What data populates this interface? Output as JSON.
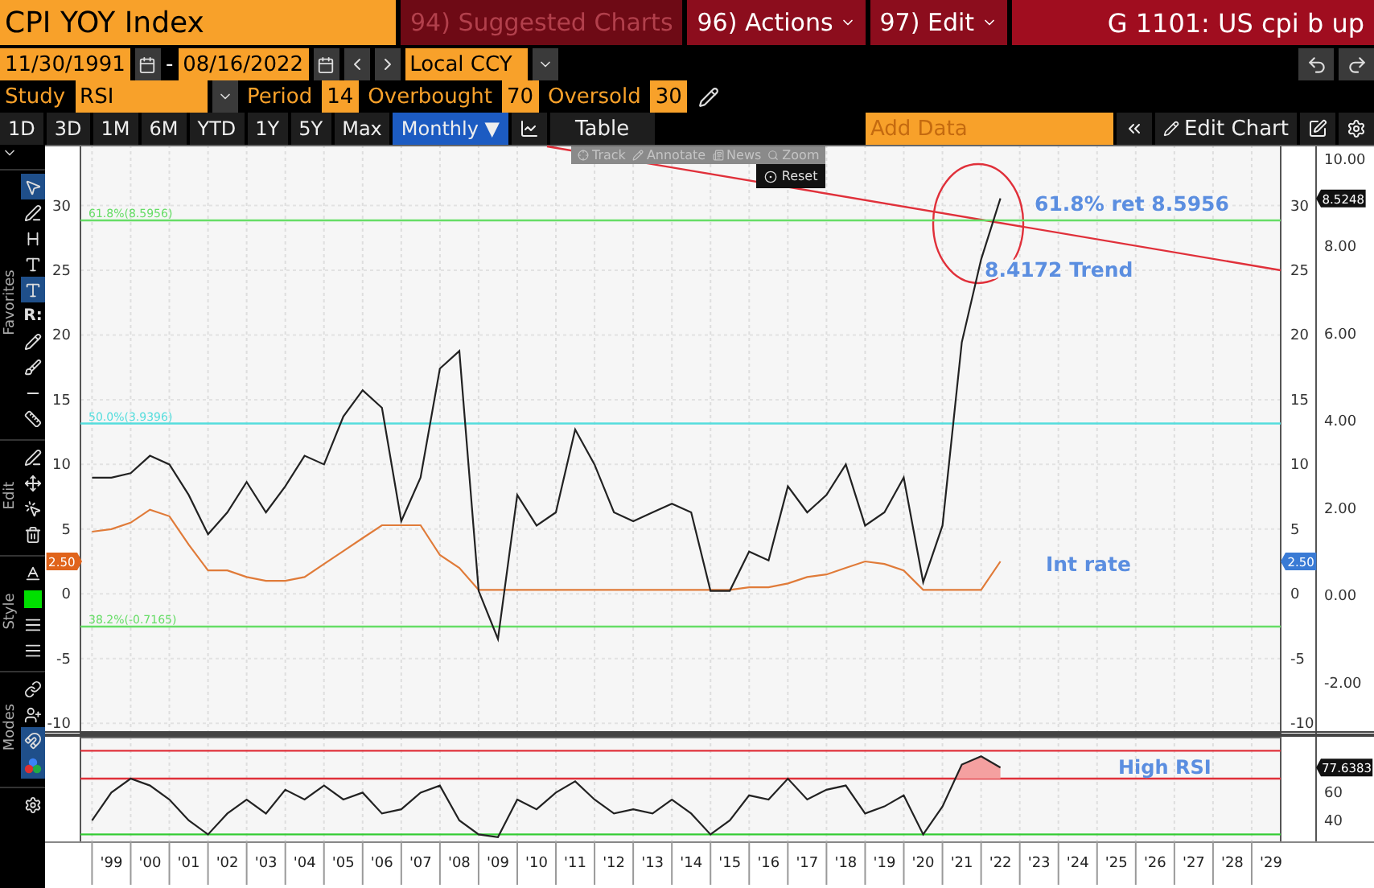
{
  "header": {
    "security": "CPI YOY Index",
    "menus": [
      {
        "label": "94) Suggested Charts",
        "kind": "faded"
      },
      {
        "label": "96) Actions",
        "kind": "dropdown"
      },
      {
        "label": "97) Edit",
        "kind": "dropdown"
      }
    ],
    "title": "G 1101: US cpi b up"
  },
  "dates": {
    "start": "11/30/1991",
    "separator": "-",
    "end": "08/16/2022",
    "currency": "Local CCY"
  },
  "study": {
    "label": "Study",
    "value": "RSI",
    "params": [
      {
        "label": "Period",
        "value": "14"
      },
      {
        "label": "Overbought",
        "value": "70"
      },
      {
        "label": "Oversold",
        "value": "30"
      }
    ]
  },
  "ranges": [
    {
      "label": "1D",
      "selected": false
    },
    {
      "label": "3D",
      "selected": false
    },
    {
      "label": "1M",
      "selected": false
    },
    {
      "label": "6M",
      "selected": false
    },
    {
      "label": "YTD",
      "selected": false
    },
    {
      "label": "1Y",
      "selected": false
    },
    {
      "label": "5Y",
      "selected": false
    },
    {
      "label": "Max",
      "selected": false
    },
    {
      "label": "Monthly ▼",
      "selected": true
    }
  ],
  "table_button": "Table",
  "add_data": {
    "placeholder": "Add Data"
  },
  "edit_chart": "Edit Chart",
  "chart_toolbar": {
    "items": [
      {
        "label": "Track",
        "disabled": true
      },
      {
        "label": "Annotate",
        "disabled": true
      },
      {
        "label": "News",
        "disabled": true
      },
      {
        "label": "Zoom",
        "disabled": true
      }
    ],
    "reset": "Reset"
  },
  "tool_sections": [
    {
      "label": "Favorites",
      "tools": [
        {
          "selected": true
        },
        {
          "selected": false
        },
        {
          "selected": false
        },
        {
          "selected": false
        },
        {
          "selected": true
        },
        {
          "text": "R:",
          "selected": false
        },
        {
          "selected": false
        },
        {
          "selected": false
        },
        {
          "selected": false
        },
        {
          "selected": false
        }
      ]
    },
    {
      "label": "Edit",
      "tools": [
        {
          "selected": false
        },
        {
          "selected": false
        },
        {
          "selected": false
        },
        {
          "selected": false
        }
      ]
    },
    {
      "label": "Style",
      "tools": [
        {
          "selected": false
        },
        {
          "color": "#00e000",
          "selected": false
        },
        {
          "selected": false
        },
        {
          "selected": false
        }
      ]
    },
    {
      "label": "Modes",
      "tools": [
        {
          "selected": false
        },
        {
          "selected": false
        },
        {
          "selected": true
        },
        {
          "selected": true
        }
      ]
    }
  ],
  "main_chart": {
    "chart_data": {
      "type": "line",
      "categories": [
        null,
        null,
        null,
        null,
        null,
        null,
        null,
        null,
        null,
        null,
        null,
        null,
        null,
        null,
        null,
        null,
        null,
        null,
        null,
        null,
        null,
        null,
        null,
        null,
        null,
        null,
        null,
        null,
        null,
        null,
        null,
        null,
        null,
        null,
        null,
        null,
        null,
        null,
        null,
        null,
        null,
        null,
        null,
        null,
        null,
        null,
        null,
        null,
        null,
        null,
        null,
        null,
        null,
        null,
        null,
        null,
        null,
        null,
        null,
        null,
        null,
        null
      ],
      "series": [
        {
          "color": "#222222",
          "values": [
            2.7,
            2.7,
            2.8,
            3.2,
            3.0,
            2.3,
            1.4,
            1.9,
            2.6,
            1.9,
            2.5,
            3.2,
            3.0,
            4.1,
            4.7,
            4.3,
            1.7,
            2.7,
            5.2,
            5.6,
            0.1,
            -1.0,
            2.3,
            1.6,
            1.9,
            3.8,
            3.0,
            1.9,
            1.7,
            1.9,
            2.1,
            1.9,
            0.1,
            0.1,
            1.0,
            0.8,
            2.5,
            1.9,
            2.3,
            3.0,
            1.6,
            1.9,
            2.7,
            0.3,
            1.6,
            5.8,
            7.7,
            9.1,
            null,
            null,
            null,
            null,
            null,
            null,
            null,
            null,
            null,
            null,
            null,
            null,
            null,
            null
          ]
        }
      ],
      "ylim": [
        -3.17,
        10.33
      ],
      "yticks": [
        {
          "value": 10,
          "label": "10.00"
        },
        {
          "value": 8,
          "label": "8.00"
        },
        {
          "value": 6,
          "label": "6.00"
        },
        {
          "value": 4,
          "label": "4.00"
        },
        {
          "value": 2,
          "label": "2.00"
        },
        {
          "value": 0,
          "label": "0.00"
        },
        {
          "value": -2,
          "label": "-2.00"
        }
      ],
      "ref_lines": [
        {
          "axis": "y",
          "value": 8.5956,
          "label": "61.8%(8.5956)",
          "color": "#66dd66"
        },
        {
          "axis": "y",
          "value": 3.9396,
          "label": "50.0%(3.9396)",
          "color": "#55dddd"
        },
        {
          "axis": "y",
          "value": -0.7165,
          "label": "38.2%(-0.7165)",
          "color": "#66dd66"
        }
      ],
      "annotations": [
        "61.8% ret 8.5956",
        "8.4172 Trend"
      ]
    },
    "value_tag": {
      "text": "8.5248",
      "color": "#111111"
    }
  },
  "rate_chart": {
    "chart_data": {
      "type": "line",
      "categories": [
        null,
        null,
        null,
        null,
        null,
        null,
        null,
        null,
        null,
        null,
        null,
        null,
        null,
        null,
        null,
        null,
        null,
        null,
        null,
        null,
        null,
        null,
        null,
        null,
        null,
        null,
        null,
        null,
        null,
        null,
        null,
        null,
        null,
        null,
        null,
        null,
        null,
        null,
        null,
        null,
        null,
        null,
        null,
        null,
        null,
        null,
        null,
        null,
        null,
        null,
        null,
        null,
        null,
        null,
        null,
        null,
        null,
        null,
        null,
        null,
        null,
        null
      ],
      "series": [
        {
          "color": "#e07b39",
          "values": [
            4.8,
            5.0,
            5.5,
            6.5,
            6.0,
            3.8,
            1.8,
            1.8,
            1.3,
            1.0,
            1.0,
            1.3,
            2.3,
            3.3,
            4.3,
            5.3,
            5.3,
            5.3,
            3.0,
            2.0,
            0.3,
            0.3,
            0.3,
            0.3,
            0.3,
            0.3,
            0.3,
            0.3,
            0.3,
            0.3,
            0.3,
            0.3,
            0.3,
            0.3,
            0.5,
            0.5,
            0.8,
            1.3,
            1.5,
            2.0,
            2.5,
            2.3,
            1.8,
            0.3,
            0.3,
            0.3,
            0.3,
            2.5,
            null,
            null,
            null,
            null,
            null,
            null,
            null,
            null,
            null,
            null,
            null,
            null,
            null,
            null
          ]
        }
      ],
      "ylim": [
        -10.8,
        34.7
      ],
      "yticks": [
        30,
        25,
        20,
        15,
        10,
        5,
        0,
        -5,
        -10
      ],
      "annotations": [
        "Int rate"
      ]
    },
    "inner_axis_labels": [
      "30",
      "25",
      "20",
      "15",
      "10",
      "5",
      "0",
      "-5",
      "-10"
    ],
    "value_tags": [
      {
        "text": "2.50",
        "color": "#e0641c"
      },
      {
        "text": "2.50",
        "color": "#3a7bd5"
      }
    ]
  },
  "rsi_chart": {
    "chart_data": {
      "type": "line",
      "categories": [
        null,
        "'99",
        null,
        "'00",
        null,
        "'01",
        null,
        "'02",
        null,
        "'03",
        null,
        "'04",
        null,
        "'05",
        null,
        "'06",
        null,
        "'07",
        null,
        "'08",
        null,
        "'09",
        null,
        "'10",
        null,
        "'11",
        null,
        "'12",
        null,
        "'13",
        null,
        "'14",
        null,
        "'15",
        null,
        "'16",
        null,
        "'17",
        null,
        "'18",
        null,
        "'19",
        null,
        "'20",
        null,
        "'21",
        null,
        "'22",
        null,
        "'23",
        null,
        "'24",
        null,
        "'25",
        null,
        "'26",
        null,
        "'27",
        null,
        "'28",
        null,
        "'29"
      ],
      "series": [
        {
          "color": "#222222",
          "values": [
            40,
            60,
            70,
            65,
            55,
            40,
            30,
            45,
            55,
            45,
            62,
            55,
            65,
            55,
            60,
            45,
            48,
            60,
            65,
            40,
            30,
            28,
            55,
            48,
            60,
            68,
            55,
            45,
            48,
            45,
            55,
            45,
            30,
            40,
            58,
            55,
            70,
            55,
            62,
            65,
            45,
            50,
            58,
            30,
            50,
            80,
            86,
            78,
            null,
            null,
            null,
            null,
            null,
            null,
            null,
            null,
            null,
            null,
            null,
            null,
            null,
            null
          ]
        }
      ],
      "ylim": [
        25,
        100
      ],
      "yticks": [
        40,
        60
      ],
      "ref_lines": [
        {
          "axis": "y",
          "value": 90,
          "color": "#e0303a"
        },
        {
          "axis": "y",
          "value": 70,
          "color": "#e0303a"
        },
        {
          "axis": "y",
          "value": 30,
          "color": "#33cc33"
        }
      ],
      "annotations": [
        "High RSI"
      ]
    },
    "value_tag": {
      "text": "77.6383",
      "color": "#111111"
    }
  }
}
